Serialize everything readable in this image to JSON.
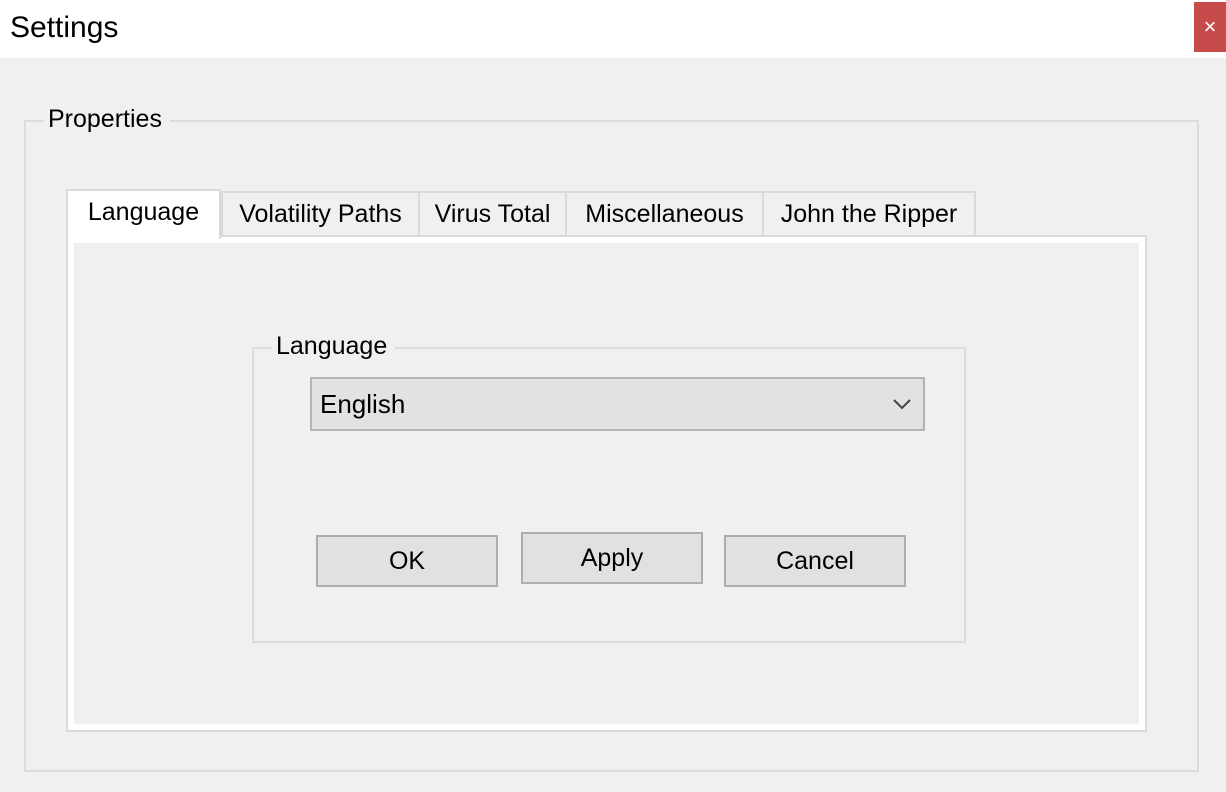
{
  "window": {
    "title": "Settings",
    "close_glyph": "×"
  },
  "properties": {
    "legend": "Properties"
  },
  "tabs": [
    {
      "label": "Language",
      "active": true
    },
    {
      "label": "Volatility Paths",
      "active": false
    },
    {
      "label": "Virus Total",
      "active": false
    },
    {
      "label": "Miscellaneous",
      "active": false
    },
    {
      "label": "John the Ripper",
      "active": false
    }
  ],
  "language_panel": {
    "legend": "Language",
    "selected_language": "English",
    "dropdown_icon": "chevron-down-icon"
  },
  "buttons": {
    "ok": "OK",
    "apply": "Apply",
    "cancel": "Cancel"
  },
  "colors": {
    "close_button_bg": "#c74b4b",
    "dialog_bg": "#f0f0f0",
    "active_tab_bg": "#ffffff"
  }
}
